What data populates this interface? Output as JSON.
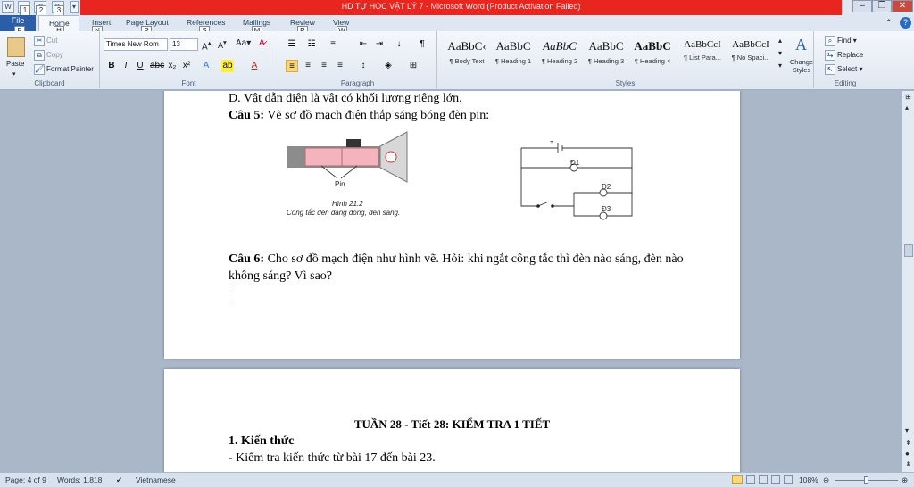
{
  "window": {
    "title": "HD TỰ HỌC VẬT LÝ 7  -  Microsoft Word (Product Activation Failed)",
    "qat_keys": [
      "1",
      "2",
      "3"
    ]
  },
  "tabs": [
    {
      "label": "File",
      "key": "F"
    },
    {
      "label": "Home",
      "key": "H"
    },
    {
      "label": "Insert",
      "key": "N"
    },
    {
      "label": "Page Layout",
      "key": "P"
    },
    {
      "label": "References",
      "key": "S"
    },
    {
      "label": "Mailings",
      "key": "M"
    },
    {
      "label": "Review",
      "key": "R"
    },
    {
      "label": "View",
      "key": "W"
    }
  ],
  "ribbon": {
    "clipboard": {
      "label": "Clipboard",
      "paste": "Paste",
      "cut": "Cut",
      "copy": "Copy",
      "format_painter": "Format Painter"
    },
    "font": {
      "label": "Font",
      "name": "Times New Rom",
      "size": "13"
    },
    "paragraph": {
      "label": "Paragraph"
    },
    "styles": {
      "label": "Styles",
      "items": [
        {
          "sample": "AaBbC‹",
          "name": "¶ Body Text"
        },
        {
          "sample": "AaBbC",
          "name": "¶ Heading 1"
        },
        {
          "sample": "AaBbC",
          "name": "¶ Heading 2"
        },
        {
          "sample": "AaBbC",
          "name": "¶ Heading 3"
        },
        {
          "sample": "AaBbC",
          "name": "¶ Heading 4"
        },
        {
          "sample": "AaBbCcI",
          "name": "¶ List Para..."
        },
        {
          "sample": "AaBbCcI",
          "name": "¶ No Spaci..."
        }
      ],
      "change_styles": "Change Styles"
    },
    "editing": {
      "label": "Editing",
      "find": "Find",
      "replace": "Replace",
      "select": "Select"
    }
  },
  "page1": {
    "line_d": "D. Vật dẫn điện là vật có khối lượng riêng lớn.",
    "q5_label": "Câu 5:",
    "q5_text": " Vẽ sơ đồ mạch điện thắp sáng bóng đèn pin:",
    "fig_pin": "Pin",
    "fig_caption1": "Hình 21.2",
    "fig_caption2": "Công tắc đèn đang đóng, đèn sáng.",
    "circuit_d1": "Đ1",
    "circuit_d2": "Đ2",
    "circuit_d3": "Đ3",
    "q6_label": "Câu 6:",
    "q6_text1": " Cho sơ đồ mạch điện như hình vẽ. Hỏi: khi ngắt công tắc thì đèn nào sáng, đèn nào",
    "q6_text2": "không sáng? Vì sao?"
  },
  "page2": {
    "heading": "TUẦN 28 - Tiết 28: KIỂM TRA 1 TIẾT",
    "section": "1. Kiến thức",
    "line1": "- Kiểm tra kiến thức từ bài 17 đến bài 23."
  },
  "status": {
    "page": "Page: 4 of 9",
    "words": "Words: 1.818",
    "language": "Vietnamese",
    "zoom": "108%"
  }
}
